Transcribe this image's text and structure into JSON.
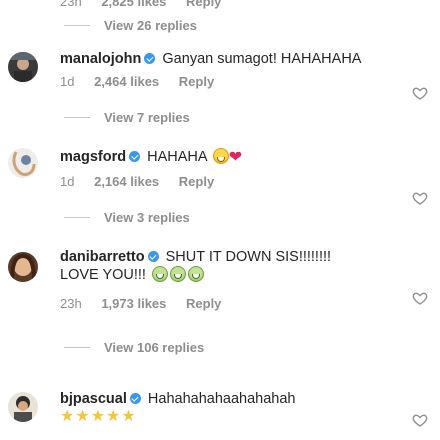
{
  "top_meta": {
    "time": "23h",
    "likes": "2,825 likes",
    "reply": "Reply"
  },
  "comments": [
    {
      "view_replies": "View 26 replies"
    },
    {
      "user": "manalojohn",
      "text": "Ganyan sumagot! HAHAHAHA",
      "time": "1d",
      "likes": "2,464 likes",
      "reply": "Reply",
      "view_replies": "View 7 replies"
    },
    {
      "user": "magsford",
      "text": "HAHAHA",
      "time": "1d",
      "likes": "2,164 likes",
      "reply": "Reply",
      "view_replies": "View 3 replies"
    },
    {
      "user": "danibarretto",
      "text": "SHUT IT DOWN SIS!!!!!!!!",
      "text2": "LOVE YOU!!!",
      "time": "23h",
      "likes": "1,973 likes",
      "reply": "Reply",
      "view_replies": "View 106 replies"
    },
    {
      "user": "bjpascual",
      "text": "Hahahahahaahahahah",
      "stars": "★★★★★"
    }
  ],
  "icons": [
    "heart-icon",
    "verified-badge-icon",
    "grinning-emoji-icon",
    "red-heart-emoji-icon",
    "star-emoji-icon"
  ],
  "colors": {
    "muted": "#8e8e8e",
    "text": "#262626",
    "verified": "#3897f0"
  }
}
